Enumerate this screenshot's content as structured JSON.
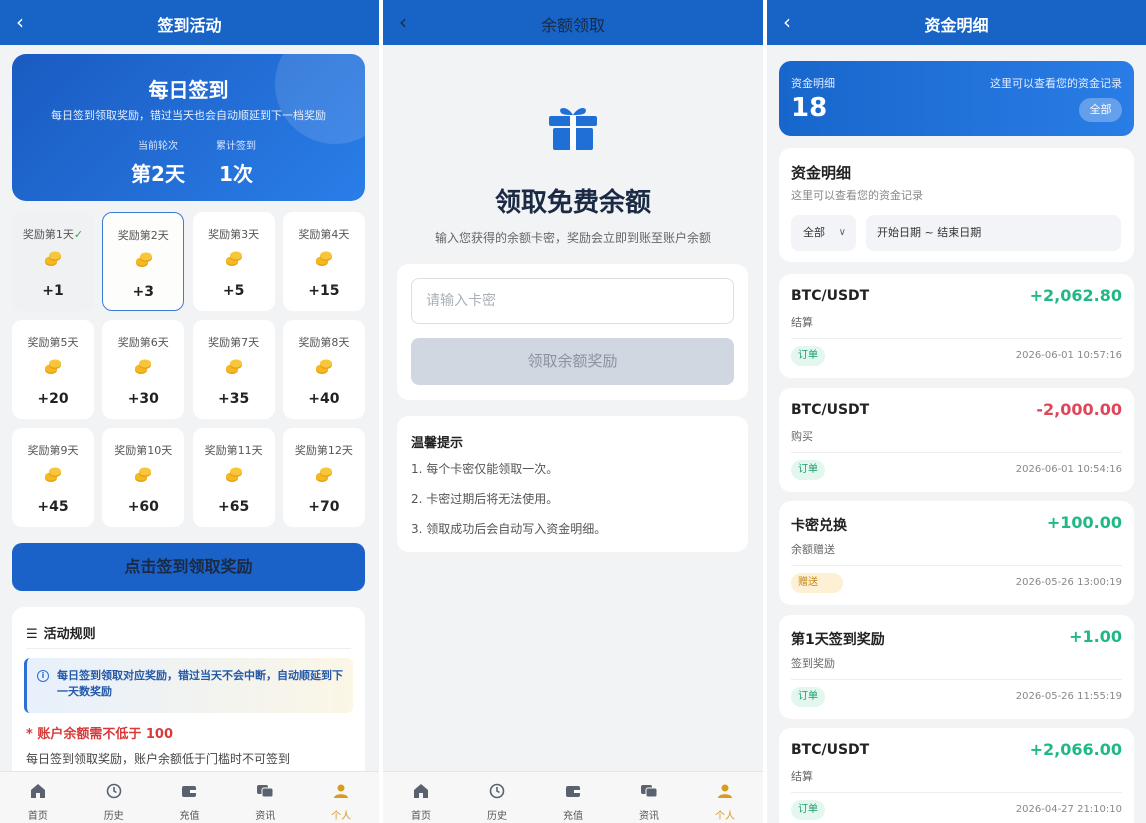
{
  "checkin": {
    "header_title": "签到活动",
    "banner": {
      "title": "每日签到",
      "subtitle": "每日签到领取奖励，错过当天也会自动顺延到下一档奖励",
      "round_label": "当前轮次",
      "round_value": "第2天",
      "total_label": "累计签到",
      "total_value": "1次"
    },
    "days": [
      {
        "label": "奖励第1天",
        "amount": "+1",
        "state": "done"
      },
      {
        "label": "奖励第2天",
        "amount": "+3",
        "state": "current"
      },
      {
        "label": "奖励第3天",
        "amount": "+5",
        "state": "normal"
      },
      {
        "label": "奖励第4天",
        "amount": "+15",
        "state": "normal"
      },
      {
        "label": "奖励第5天",
        "amount": "+20",
        "state": "normal"
      },
      {
        "label": "奖励第6天",
        "amount": "+30",
        "state": "normal"
      },
      {
        "label": "奖励第7天",
        "amount": "+35",
        "state": "normal"
      },
      {
        "label": "奖励第8天",
        "amount": "+40",
        "state": "normal"
      },
      {
        "label": "奖励第9天",
        "amount": "+45",
        "state": "normal"
      },
      {
        "label": "奖励第10天",
        "amount": "+60",
        "state": "normal"
      },
      {
        "label": "奖励第11天",
        "amount": "+65",
        "state": "normal"
      },
      {
        "label": "奖励第12天",
        "amount": "+70",
        "state": "normal"
      }
    ],
    "check_mark": "✓",
    "sign_button": "点击签到领取奖励",
    "rules": {
      "title": "活动规则",
      "note": "每日签到领取对应奖励，错过当天不会中断，自动顺延到下一天数奖励",
      "warning": "* 账户余额需不低于 100",
      "description": "每日签到领取奖励，账户余额低于门槛时不可签到"
    }
  },
  "redeem": {
    "header_title": "余额领取",
    "icon": "gift-icon",
    "title": "领取免费余额",
    "subtitle": "输入您获得的余额卡密，奖励会立即到账至账户余额",
    "input_placeholder": "请输入卡密",
    "input_value": "",
    "button": "领取余额奖励",
    "tips_title": "温馨提示",
    "tips": [
      "1. 每个卡密仅能领取一次。",
      "2. 卡密过期后将无法使用。",
      "3. 领取成功后会自动写入资金明细。"
    ]
  },
  "tabbar": [
    {
      "label": "首页",
      "icon": "home-icon"
    },
    {
      "label": "历史",
      "icon": "history-icon"
    },
    {
      "label": "充值",
      "icon": "wallet-icon"
    },
    {
      "label": "资讯",
      "icon": "news-icon"
    },
    {
      "label": "个人",
      "icon": "user-icon",
      "active": true
    }
  ],
  "funds": {
    "header_title": "资金明细",
    "summary": {
      "label": "资金明细",
      "count": "18",
      "hint": "这里可以查看您的资金记录",
      "all_button": "全部"
    },
    "filter": {
      "title": "资金明细",
      "subtitle": "这里可以查看您的资金记录",
      "type_value": "全部",
      "date_range": "开始日期 ~ 结束日期"
    },
    "records": [
      {
        "name": "BTC/USDT",
        "amount": "+2,062.80",
        "sign": "pos",
        "type": "结算",
        "tag": "订单",
        "tag_kind": "order",
        "time": "2026-06-01 10:57:16"
      },
      {
        "name": "BTC/USDT",
        "amount": "-2,000.00",
        "sign": "neg",
        "type": "购买",
        "tag": "订单",
        "tag_kind": "order",
        "time": "2026-06-01 10:54:16"
      },
      {
        "name": "卡密兑换",
        "amount": "+100.00",
        "sign": "pos",
        "type": "余额赠送",
        "tag": "赠送",
        "tag_kind": "gift",
        "time": "2026-05-26 13:00:19"
      },
      {
        "name": "第1天签到奖励",
        "amount": "+1.00",
        "sign": "pos",
        "type": "签到奖励",
        "tag": "订单",
        "tag_kind": "order",
        "time": "2026-05-26 11:55:19"
      },
      {
        "name": "BTC/USDT",
        "amount": "+2,066.00",
        "sign": "pos",
        "type": "结算",
        "tag": "订单",
        "tag_kind": "order",
        "time": "2026-04-27 21:10:10"
      }
    ]
  },
  "colors": {
    "primary": "#1764c6",
    "positive": "#1fb985",
    "negative": "#e0455a",
    "coin": "#f5b820",
    "active_tab": "#d99a1e"
  }
}
